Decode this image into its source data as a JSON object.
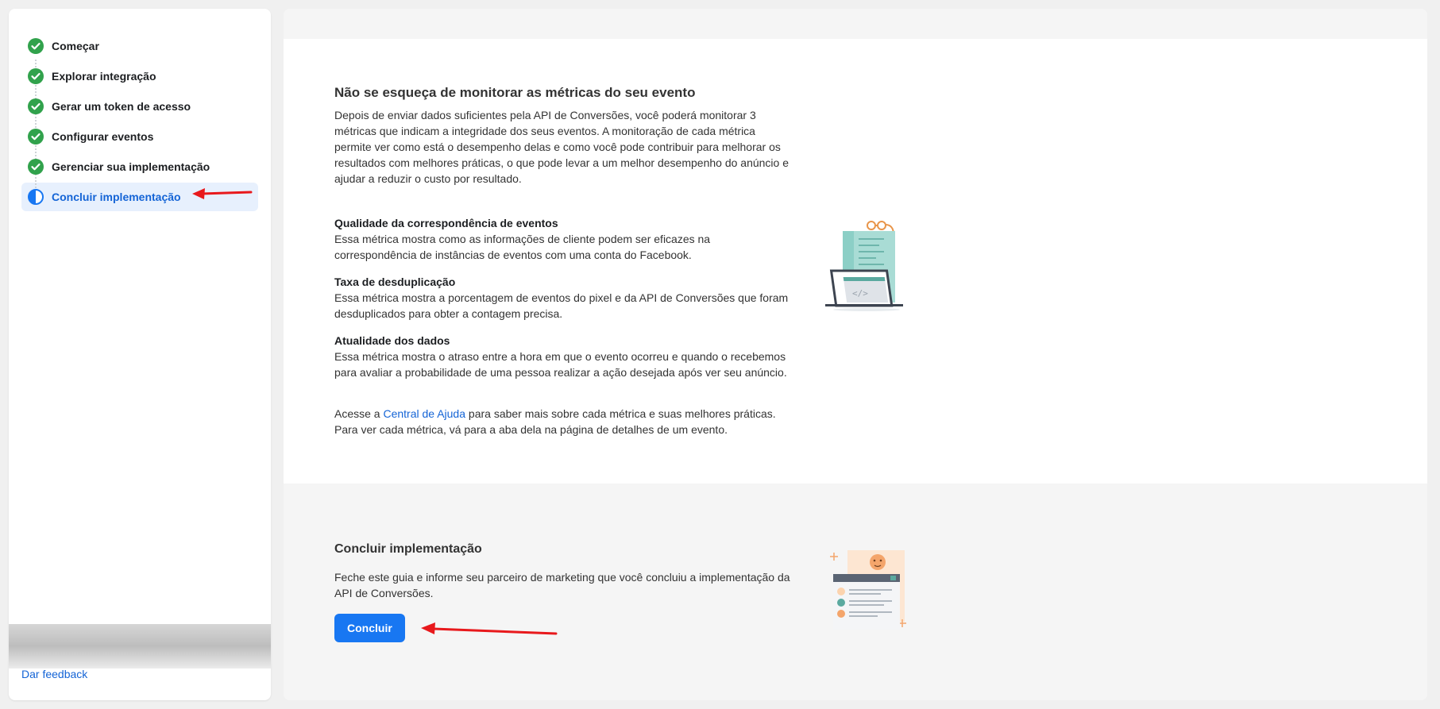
{
  "sidebar": {
    "steps": [
      {
        "label": "Começar",
        "status": "done"
      },
      {
        "label": "Explorar integração",
        "status": "done"
      },
      {
        "label": "Gerar um token de acesso",
        "status": "done"
      },
      {
        "label": "Configurar eventos",
        "status": "done"
      },
      {
        "label": "Gerenciar sua implementação",
        "status": "done"
      },
      {
        "label": "Concluir implementação",
        "status": "in-progress"
      }
    ],
    "feedback": "Dar feedback"
  },
  "metrics_section": {
    "title": "Não se esqueça de monitorar as métricas do seu evento",
    "intro": "Depois de enviar dados suficientes pela API de Conversões, você poderá monitorar 3 métricas que indicam a integridade dos seus eventos. A monitoração de cada métrica permite ver como está o desempenho delas e como você pode contribuir para melhorar os resultados com melhores práticas, o que pode levar a um melhor desempenho do anúncio e ajudar a reduzir o custo por resultado.",
    "metrics": [
      {
        "title": "Qualidade da correspondência de eventos",
        "desc": "Essa métrica mostra como as informações de cliente podem ser eficazes na correspondência de instâncias de eventos com uma conta do Facebook."
      },
      {
        "title": "Taxa de desduplicação",
        "desc": "Essa métrica mostra a porcentagem de eventos do pixel e da API de Conversões que foram desduplicados para obter a contagem precisa."
      },
      {
        "title": "Atualidade dos dados",
        "desc": "Essa métrica mostra o atraso entre a hora em que o evento ocorreu e quando o recebemos para avaliar a probabilidade de uma pessoa realizar a ação desejada após ver seu anúncio."
      }
    ],
    "help_prefix": "Acesse a ",
    "help_link": "Central de Ajuda",
    "help_suffix": " para saber mais sobre cada métrica e suas melhores práticas. Para ver cada métrica, vá para a aba dela na página de detalhes de um evento."
  },
  "finish_section": {
    "title": "Concluir implementação",
    "desc": "Feche este guia e informe seu parceiro de marketing que você concluiu a implementação da API de Conversões.",
    "button": "Concluir"
  },
  "colors": {
    "accent": "#1877f2",
    "success": "#31a24c",
    "link": "#1464d6",
    "annotation": "#e8191c"
  }
}
